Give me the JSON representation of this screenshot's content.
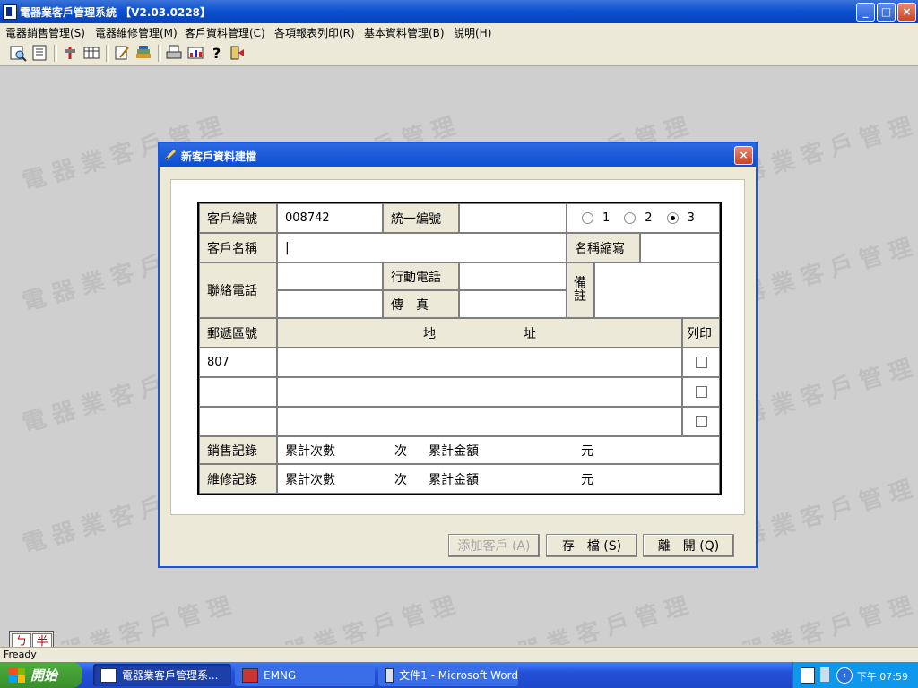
{
  "window": {
    "title": "電器業客戶管理系統 【V2.03.0228】",
    "buttons": {
      "minimize": "_",
      "maximize": "□",
      "close": "×"
    }
  },
  "menu": {
    "items": [
      "電器銷售管理(S)",
      "電器維修管理(M)",
      "客戶資料管理(C)",
      "各項報表列印(R)",
      "基本資料管理(B)",
      "說明(H)"
    ]
  },
  "toolbar": {
    "icons": [
      "customer-search-icon",
      "record-icon",
      "tool-icon",
      "table-icon",
      "edit-icon",
      "books-icon",
      "print-icon",
      "report-icon",
      "help-icon",
      "exit-icon"
    ]
  },
  "watermark": {
    "text": "電器業客戶管理"
  },
  "dialog": {
    "title": "新客戶資料建檔",
    "close": "×",
    "form": {
      "customer_no_label": "客戶編號",
      "customer_no_value": "008742",
      "tax_id_label": "統一編號",
      "tax_id_value": "",
      "radio_options": [
        "1",
        "2",
        "3"
      ],
      "radio_selected": "3",
      "customer_name_label": "客戶名稱",
      "customer_name_value": "|",
      "short_name_label": "名稱縮寫",
      "short_name_value": "",
      "contact_phone_label": "聯絡電話",
      "contact_phone_1": "",
      "contact_phone_2": "",
      "mobile_label": "行動電話",
      "mobile_value": "",
      "fax_label": "傳　真",
      "fax_value": "",
      "remark_label": "備註",
      "remark_value": "",
      "postal_header": "郵遞區號",
      "address_header": "地　　　　　　　址",
      "print_header": "列印",
      "address_rows": [
        {
          "postal": "807",
          "address": ""
        },
        {
          "postal": "",
          "address": ""
        },
        {
          "postal": "",
          "address": ""
        }
      ],
      "sales_label": "銷售記錄",
      "repair_label": "維修記錄",
      "count_label": "累計次數",
      "count_unit": "次",
      "amount_label": "累計金額",
      "amount_unit": "元",
      "sales_count": "",
      "sales_amount": "",
      "repair_count": "",
      "repair_amount": ""
    },
    "buttons": {
      "add": "添加客戶 (A)",
      "save": "存　檔 (S)",
      "exit": "離　開 (Q)"
    }
  },
  "ime": {
    "a": "ㄅ",
    "b": "半"
  },
  "status": {
    "text": "Fready"
  },
  "taskbar": {
    "start": "開始",
    "tasks": [
      "電器業客戶管理系...",
      "EMNG",
      "文件1 - Microsoft Word"
    ],
    "clock": "下午 07:59"
  }
}
